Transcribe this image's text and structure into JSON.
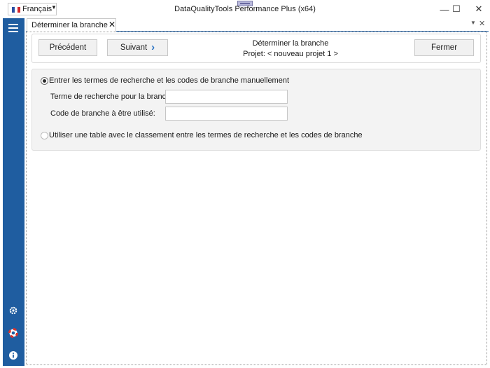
{
  "window": {
    "title": "DataQualityTools Performance Plus (x64)",
    "language": "Français",
    "controls": {
      "minimize": "—",
      "maximize": "☐",
      "close": "✕"
    }
  },
  "tab": {
    "label": "Déterminer la branche",
    "close": "✕"
  },
  "toolbar": {
    "prev_label": "Précédent",
    "next_label": "Suivant",
    "next_arrow": "›",
    "step_title": "Déterminer la branche",
    "project": "Projet: < nouveau projet 1 >",
    "close_label": "Fermer"
  },
  "options": {
    "manual": {
      "label": "Entrer les termes de recherche et les codes de branche manuellement",
      "selected": true
    },
    "search_term": {
      "label": "Terme de recherche pour la branche:",
      "value": ""
    },
    "branch_code": {
      "label": "Code de branche à être utilisé:",
      "value": ""
    },
    "table": {
      "label": "Utiliser une table avec le classement entre les termes de recherche et les codes de branche",
      "selected": false
    }
  },
  "sidebar": {
    "icons": [
      "menu-icon",
      "gear-icon",
      "lifebuoy-icon",
      "info-icon"
    ]
  },
  "colors": {
    "sidebar": "#1f5da0",
    "accent": "#2a73c4",
    "panel": "#f3f3f3"
  }
}
